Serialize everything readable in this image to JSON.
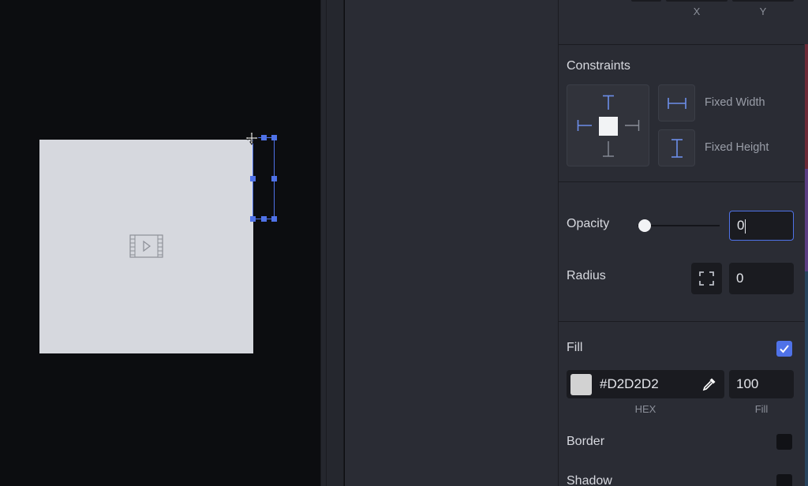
{
  "canvas": {
    "frame_color": "#D6D8DE",
    "selection_color": "#4F72E8",
    "video_icon": "video-play-icon",
    "cursor_icon": "move-cursor-icon"
  },
  "inspector": {
    "position_labels": {
      "x": "X",
      "y": "Y"
    },
    "constraints": {
      "title": "Constraints",
      "fixed_width_label": "Fixed Width",
      "fixed_height_label": "Fixed Height",
      "accent": "#6D8EEA"
    },
    "opacity": {
      "label": "Opacity",
      "value": "0",
      "slider_fraction": 0.0
    },
    "radius": {
      "label": "Radius",
      "value": "0",
      "icon": "corner-radius-icon"
    },
    "fill": {
      "label": "Fill",
      "checked": true,
      "hex_value": "#D2D2D2",
      "swatch_color": "#D2D2D2",
      "amount": "100",
      "hex_caption": "HEX",
      "amount_caption": "Fill",
      "picker_icon": "eyedropper-icon"
    },
    "border": {
      "label": "Border",
      "checked": false
    },
    "shadow": {
      "label": "Shadow",
      "checked": false
    }
  }
}
